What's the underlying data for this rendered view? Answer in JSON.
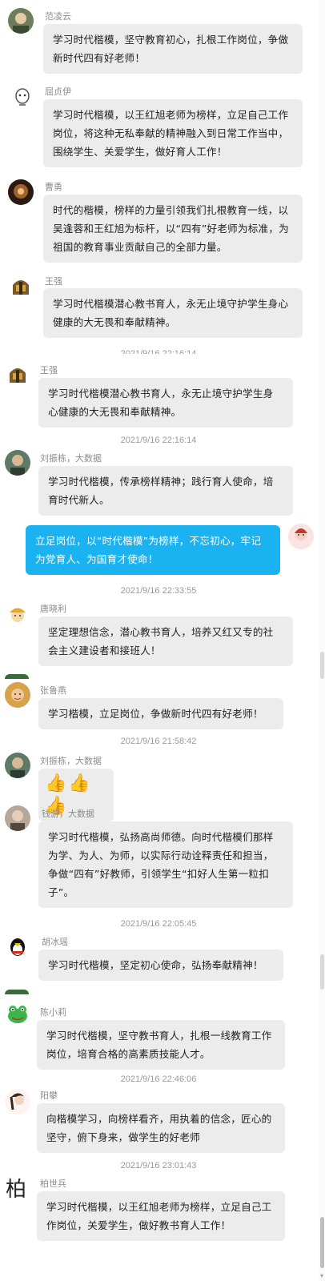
{
  "messages": [
    {
      "sender": "范凌云",
      "text": "学习时代楷模，坚守教育初心，扎根工作岗位，争做新时代四有好老师！"
    },
    {
      "sender": "屈贞伊",
      "text": "学习时代楷模，以王红旭老师为榜样，立足自己工作岗位，将这种无私奉献的精神融入到日常工作当中，围绕学生、关爱学生，做好育人工作！"
    },
    {
      "sender": "曹勇",
      "text": "时代的楷模，榜样的力量引领我们扎根教育一线，以吴逢蓉和王红旭为标杆，以“四有”好老师为标准，为祖国的教育事业贡献自己的全部力量。"
    },
    {
      "sender": "王强",
      "text": "学习时代楷模潜心教书育人，永无止境守护学生身心健康的大无畏和奉献精神。"
    },
    {
      "sender": "王强",
      "text": "学习时代楷模潜心教书育人，永无止境守护学生身心健康的大无畏和奉献精神。"
    },
    {
      "sender": "刘振栋，大数据",
      "text": "学习时代楷模，传承榜样精神；践行育人使命，培育时代新人。"
    },
    {
      "sender": "",
      "text": "立足岗位，以“时代楷模”为榜样，不忘初心，牢记为党育人、为国育才使命！"
    },
    {
      "sender": "唐晓利",
      "text": "坚定理想信念，潜心教书育人，培养又红又专的社会主义建设者和接班人！"
    },
    {
      "sender": "张鲁燕",
      "text": "学习楷模，立足岗位，争做新时代四有好老师！"
    },
    {
      "sender": "刘振栋，大数据",
      "text": "👍👍👍"
    },
    {
      "sender": "钱游，大数据",
      "text": "学习时代楷模，弘扬高尚师德。向时代楷模们那样为学、为人、为师，以实际行动诠释责任和担当，争做“四有”好教师，引领学生“扣好人生第一粒扣子”。"
    },
    {
      "sender": "胡冰瑶",
      "text": "学习时代楷模，坚定初心使命，弘扬奉献精神！"
    },
    {
      "sender": "陈小莉",
      "text": "学习时代楷模，坚守教书育人，扎根一线教育工作岗位，培育合格的高素质技能人才。"
    },
    {
      "sender": "阳攀",
      "text": "向楷模学习，向榜样看齐，用执着的信念，匠心的坚守，俯下身来，做学生的好老师"
    },
    {
      "sender": "柏世兵",
      "text": "学习时代楷模，以王红旭老师为榜样，立足自己工作岗位，关爱学生，做好教书育人工作！"
    }
  ],
  "timestamps": [
    "2021/9/16 22:16:14",
    "2021/9/16 22:16:14",
    "2021/9/16 22:33:55",
    "2021/9/16 21:58:42",
    "2021/9/16 22:05:45",
    "2021/9/16 22:46:06",
    "2021/9/16 23:01:43"
  ],
  "avatar_glyph_bai": "柏",
  "colors": {
    "bubble_other": "#ececec",
    "bubble_self": "#1ab2f0",
    "timestamp": "#9a9a9a"
  },
  "icons": {
    "scroll_down": "chevron-down-icon"
  }
}
